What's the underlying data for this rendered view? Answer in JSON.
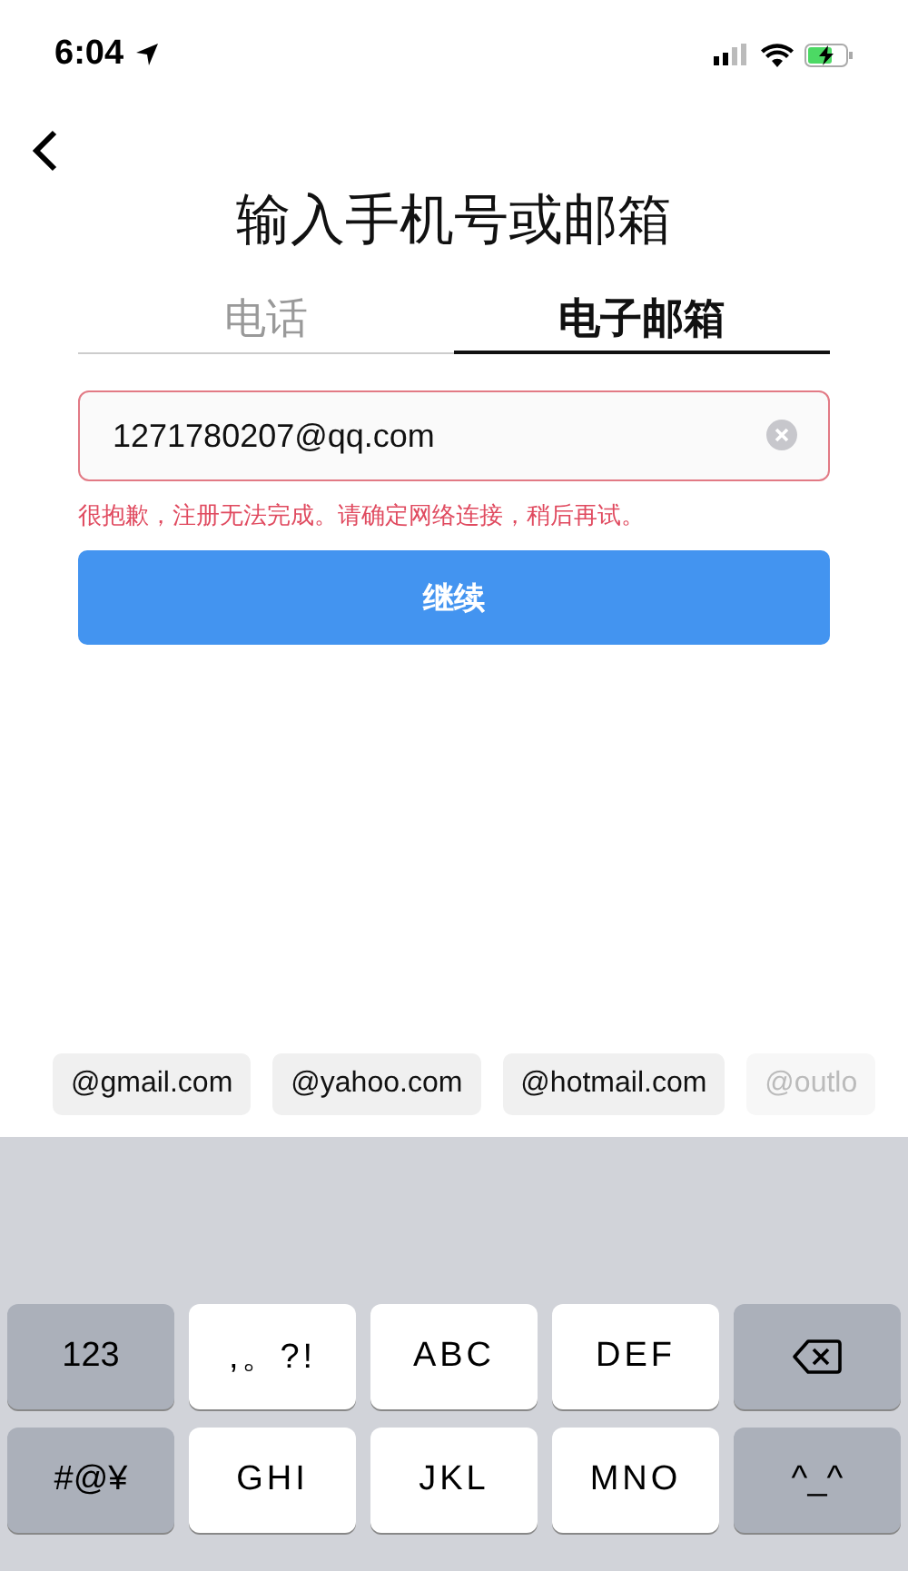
{
  "status_bar": {
    "time": "6:04"
  },
  "title": "输入手机号或邮箱",
  "tabs": [
    {
      "label": "电话",
      "selected": false
    },
    {
      "label": "电子邮箱",
      "selected": true
    }
  ],
  "email_field": {
    "value": "1271780207@qq.com",
    "invalid": true
  },
  "error": "很抱歉，注册无法完成。请确定网络连接，稍后再试。",
  "continue_button": "继续",
  "suggestions": [
    {
      "label": "@gmail.com",
      "faded": false
    },
    {
      "label": "@yahoo.com",
      "faded": false
    },
    {
      "label": "@hotmail.com",
      "faded": false
    },
    {
      "label": "@outlo",
      "faded": true
    }
  ],
  "keyboard": [
    [
      {
        "kind": "function",
        "label": "123"
      },
      {
        "kind": "letter",
        "label": ",。?!"
      },
      {
        "kind": "letter",
        "label": "ABC"
      },
      {
        "kind": "letter",
        "label": "DEF"
      },
      {
        "kind": "delete"
      }
    ],
    [
      {
        "kind": "function",
        "label": "#@¥"
      },
      {
        "kind": "letter",
        "label": "GHI"
      },
      {
        "kind": "letter",
        "label": "JKL"
      },
      {
        "kind": "letter",
        "label": "MNO"
      },
      {
        "kind": "function",
        "label": "^_^"
      }
    ]
  ]
}
